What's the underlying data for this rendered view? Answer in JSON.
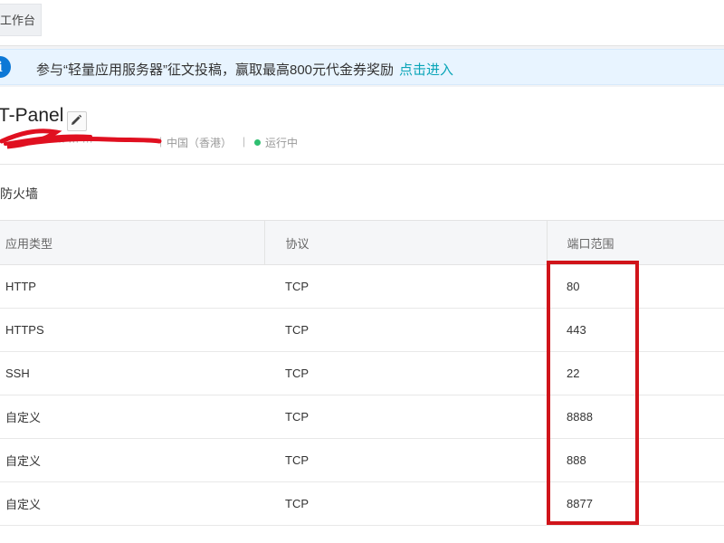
{
  "topbar": {
    "workspace_label": "工作台"
  },
  "notice": {
    "icon": "info-icon",
    "text": "参与“轻量应用服务器”征文投稿，赢取最高800元代金券奖励",
    "link_label": "点击进入"
  },
  "instance": {
    "title": "T-Panel",
    "region": "中国（香港）",
    "separator": "|",
    "status": "运行中",
    "status_color": "#2fbf71"
  },
  "firewall": {
    "section_title": "防火墙",
    "columns": [
      "应用类型",
      "协议",
      "端口范围"
    ],
    "rows": [
      [
        "HTTP",
        "TCP",
        "80"
      ],
      [
        "HTTPS",
        "TCP",
        "443"
      ],
      [
        "SSH",
        "TCP",
        "22"
      ],
      [
        "自定义",
        "TCP",
        "8888"
      ],
      [
        "自定义",
        "TCP",
        "888"
      ],
      [
        "自定义",
        "TCP",
        "8877"
      ]
    ]
  },
  "colors": {
    "accent": "#0d78d6",
    "link": "#0aa5b8",
    "highlight": "#d0141a",
    "redaction": "#e01020"
  }
}
